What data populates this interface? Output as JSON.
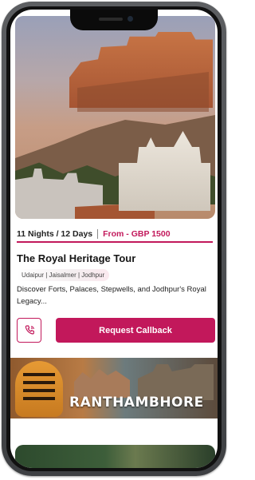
{
  "tour": {
    "duration": "11 Nights / 12 Days",
    "price": "From - GBP 1500",
    "title": "The Royal Heritage Tour",
    "places": "Udaipur | Jaisalmer | Jodhpur",
    "description": "Discover Forts, Palaces, Stepwells, and Jodhpur's Royal Legacy..."
  },
  "actions": {
    "call_icon": "phone-icon",
    "callback_label": "Request Callback"
  },
  "next_tour": {
    "banner_text": "RANTHAMBHORE"
  },
  "colors": {
    "accent": "#c2185b",
    "frame": "#4a4c4f"
  }
}
